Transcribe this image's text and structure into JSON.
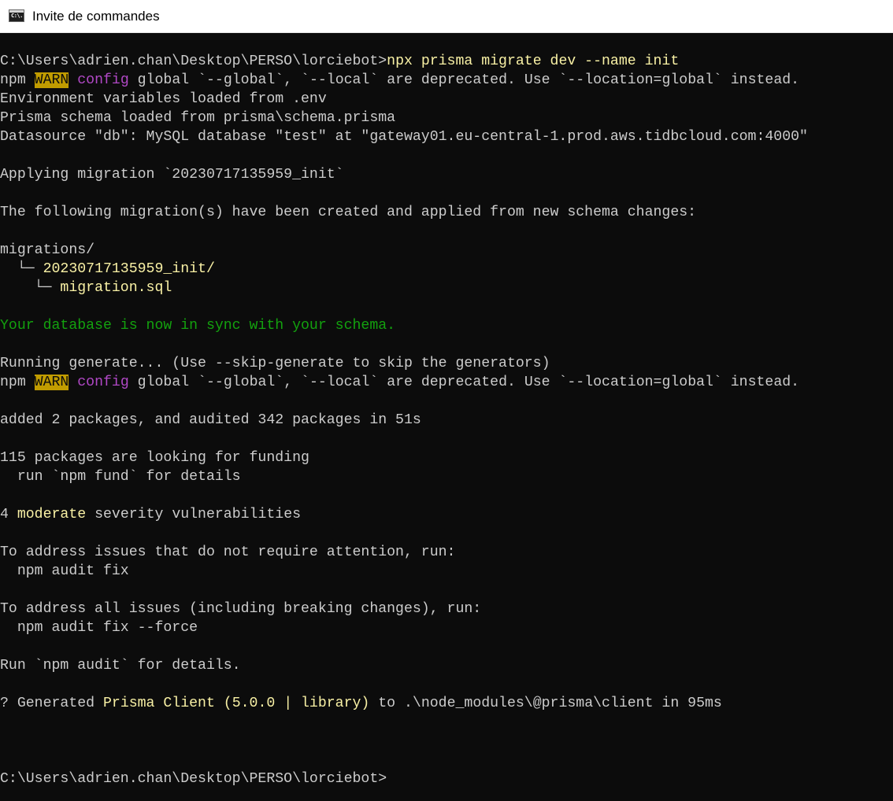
{
  "window": {
    "title": "Invite de commandes",
    "icon_glyph": "C:\\."
  },
  "colors": {
    "background": "#0c0c0c",
    "default_text": "#cccccc",
    "command_yellow": "#f9f1a5",
    "warn_bg": "#c19c00",
    "magenta": "#b148c6",
    "success_green": "#13a10e"
  },
  "console": {
    "prompt1": "C:\\Users\\adrien.chan\\Desktop\\PERSO\\lorciebot>",
    "command": "npx prisma migrate dev --name init",
    "warn1_prefix": "npm ",
    "warn_label": "WARN",
    "config_label": "config",
    "warn1_rest": " global `--global`, `--local` are deprecated. Use `--location=global` instead.",
    "env_loaded": "Environment variables loaded from .env",
    "schema_loaded": "Prisma schema loaded from prisma\\schema.prisma",
    "datasource": "Datasource \"db\": MySQL database \"test\" at \"gateway01.eu-central-1.prod.aws.tidbcloud.com:4000\"",
    "applying": "Applying migration `20230717135959_init`",
    "following": "The following migration(s) have been created and applied from new schema changes:",
    "migrations_dir": "migrations/",
    "tree1_prefix": "  └─ ",
    "migration_folder": "20230717135959_init/",
    "tree2_prefix": "    └─ ",
    "migration_file": "migration.sql",
    "in_sync": "Your database is now in sync with your schema.",
    "running_generate": "Running generate... (Use --skip-generate to skip the generators)",
    "added_packages": "added 2 packages, and audited 342 packages in 51s",
    "funding": "115 packages are looking for funding",
    "fund_details": "  run `npm fund` for details",
    "vuln_count": "4 ",
    "vuln_level": "moderate",
    "vuln_rest": " severity vulnerabilities",
    "address_no_attention": "To address issues that do not require attention, run:",
    "audit_fix": "  npm audit fix",
    "address_all": "To address all issues (including breaking changes), run:",
    "audit_fix_force": "  npm audit fix --force",
    "run_audit": "Run `npm audit` for details.",
    "generated_prefix": "? Generated ",
    "generated_client": "Prisma Client",
    "generated_version": " (5.0.0 | library)",
    "generated_rest": " to .\\node_modules\\@prisma\\client in 95ms",
    "prompt2": "C:\\Users\\adrien.chan\\Desktop\\PERSO\\lorciebot>"
  }
}
